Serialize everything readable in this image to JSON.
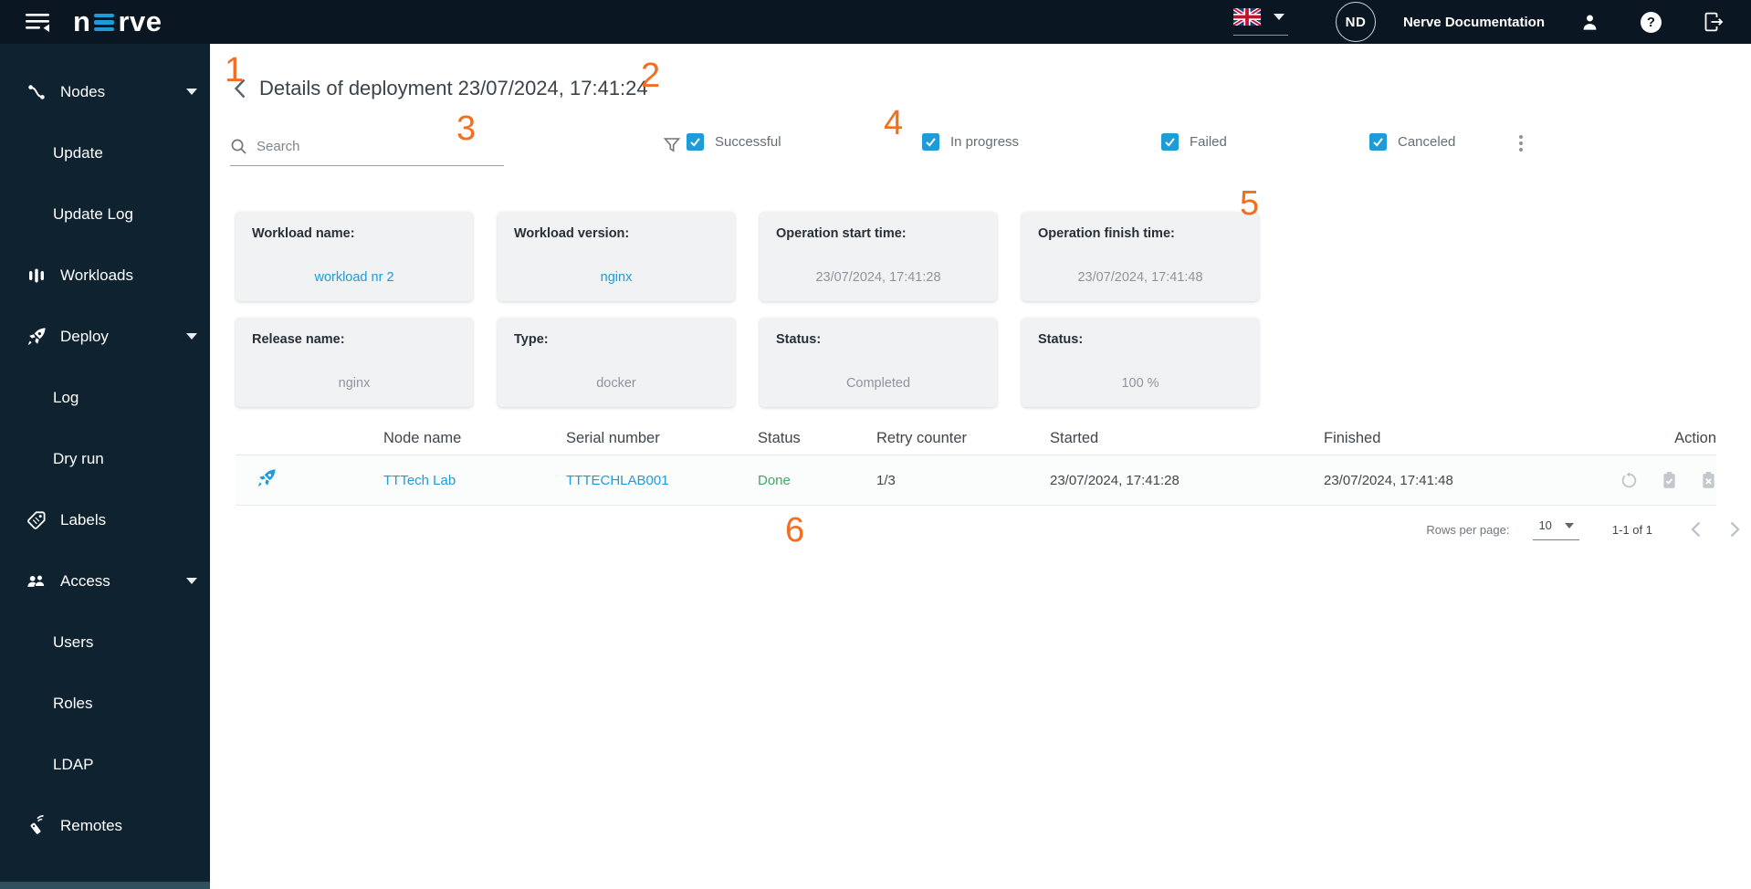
{
  "topbar": {
    "logo_n": "n",
    "logo_rve": "rve",
    "avatar_initials": "ND",
    "doc_label": "Nerve Documentation",
    "help_glyph": "?"
  },
  "sidebar": {
    "items": [
      {
        "label": "Nodes",
        "icon": "nodes-icon",
        "expandable": true
      },
      {
        "label": "Update",
        "indent": true
      },
      {
        "label": "Update Log",
        "indent": true
      },
      {
        "label": "Workloads",
        "icon": "workloads-icon"
      },
      {
        "label": "Deploy",
        "icon": "deploy-icon",
        "expandable": true
      },
      {
        "label": "Log",
        "indent": true
      },
      {
        "label": "Dry run",
        "indent": true
      },
      {
        "label": "Labels",
        "icon": "labels-icon"
      },
      {
        "label": "Access",
        "icon": "access-icon",
        "expandable": true
      },
      {
        "label": "Users",
        "indent": true
      },
      {
        "label": "Roles",
        "indent": true
      },
      {
        "label": "LDAP",
        "indent": true
      },
      {
        "label": "Remotes",
        "icon": "remotes-icon"
      }
    ]
  },
  "page": {
    "title": "Details of deployment 23/07/2024, 17:41:24",
    "search_placeholder": "Search",
    "filters": [
      {
        "label": "Successful",
        "checked": true
      },
      {
        "label": "In progress",
        "checked": true
      },
      {
        "label": "Failed",
        "checked": true
      },
      {
        "label": "Canceled",
        "checked": true
      }
    ]
  },
  "cards": [
    {
      "label": "Workload name:",
      "value": "workload nr 2",
      "style": "link"
    },
    {
      "label": "Workload version:",
      "value": "nginx",
      "style": "link"
    },
    {
      "label": "Operation start time:",
      "value": "23/07/2024, 17:41:28",
      "style": "muted"
    },
    {
      "label": "Operation finish time:",
      "value": "23/07/2024, 17:41:48",
      "style": "muted"
    },
    {
      "label": "Release name:",
      "value": "nginx",
      "style": "muted"
    },
    {
      "label": "Type:",
      "value": "docker",
      "style": "muted"
    },
    {
      "label": "Status:",
      "value": "Completed",
      "style": "muted"
    },
    {
      "label": "Status:",
      "value": "100 %",
      "style": "muted"
    }
  ],
  "table": {
    "columns": [
      "Node name",
      "Serial number",
      "Status",
      "Retry counter",
      "Started",
      "Finished",
      "Action"
    ],
    "rows": [
      {
        "node_name": "TTTech Lab",
        "serial_number": "TTTECHLAB001",
        "status": "Done",
        "retry_counter": "1/3",
        "started": "23/07/2024, 17:41:28",
        "finished": "23/07/2024, 17:41:48",
        "action_icons": [
          "retry-icon",
          "clipboard-check-icon",
          "clipboard-x-icon"
        ]
      }
    ]
  },
  "pagination": {
    "rows_per_page_label": "Rows per page:",
    "rows_per_page_value": "10",
    "range_label": "1-1 of 1"
  },
  "annotations": [
    "1",
    "2",
    "3",
    "4",
    "5",
    "6"
  ],
  "colors": {
    "topbar_bg": "#0a1722",
    "sidebar_bg": "#0e2230",
    "accent_blue": "#1e9cd7",
    "status_green": "#46a566",
    "annotation_orange": "#f26e21",
    "card_bg": "#f0f2f4"
  }
}
